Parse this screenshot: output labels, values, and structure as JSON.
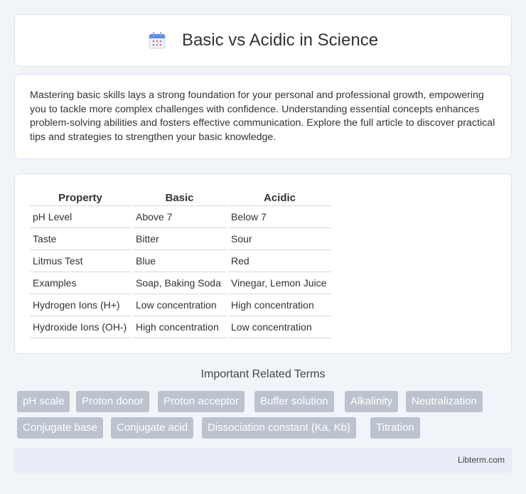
{
  "header": {
    "title": "Basic vs Acidic in Science",
    "icon": "calendar-icon",
    "icon_color": "#5b8def"
  },
  "intro": {
    "text": "Mastering basic skills lays a strong foundation for your personal and professional growth, empowering you to tackle more complex challenges with confidence. Understanding essential concepts enhances problem-solving abilities and fosters effective communication. Explore the full article to discover practical tips and strategies to strengthen your basic knowledge."
  },
  "table": {
    "headers": [
      "Property",
      "Basic",
      "Acidic"
    ],
    "rows": [
      [
        "pH Level",
        "Above 7",
        "Below 7"
      ],
      [
        "Taste",
        "Bitter",
        "Sour"
      ],
      [
        "Litmus Test",
        "Blue",
        "Red"
      ],
      [
        "Examples",
        "Soap, Baking Soda",
        "Vinegar, Lemon Juice"
      ],
      [
        "Hydrogen Ions (H+)",
        "Low concentration",
        "High concentration"
      ],
      [
        "Hydroxide Ions (OH-)",
        "High concentration",
        "Low concentration"
      ]
    ]
  },
  "terms": {
    "title": "Important Related Terms",
    "items": [
      "pH scale",
      "Proton donor",
      "Proton acceptor",
      "Buffer solution",
      "Alkalinity",
      "Neutralization",
      "Conjugate base",
      "Conjugate acid",
      "Dissociation constant (Ka, Kb)",
      "Titration"
    ]
  },
  "footer": {
    "brand": "Libterm.com"
  }
}
